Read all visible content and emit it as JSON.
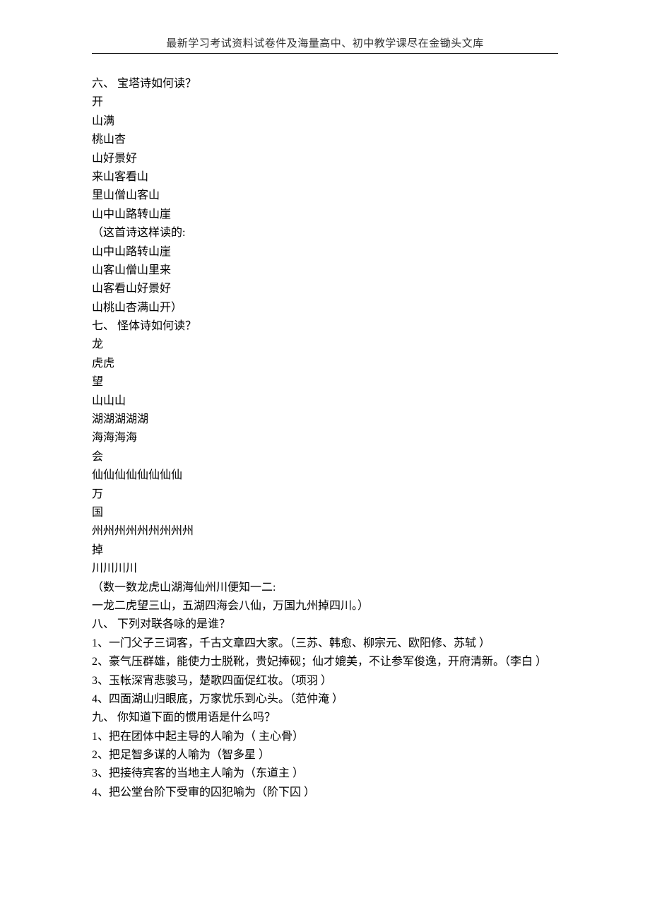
{
  "header": "最新学习考试资料试卷件及海量高中、初中教学课尽在金锄头文库",
  "lines": [
    "六、 宝塔诗如何读？",
    "开",
    "山满",
    "桃山杏",
    "山好景好",
    "来山客看山",
    "里山僧山客山",
    "山中山路转山崖",
    "（这首诗这样读的:",
    "山中山路转山崖",
    "山客山僧山里来",
    "山客看山好景好",
    "山桃山杏满山开）",
    "七、 怪体诗如何读？",
    "龙",
    "虎虎",
    "望",
    "山山山",
    "湖湖湖湖湖",
    "海海海海",
    "会",
    "仙仙仙仙仙仙仙仙",
    "万",
    "国",
    "州州州州州州州州州",
    "掉",
    "川川川川",
    "（数一数龙虎山湖海仙州川便知一二:",
    "一龙二虎望三山，五湖四海会八仙，万国九州掉四川。）",
    "八、 下列对联各咏的是谁？",
    "1、一门父子三词客，千古文章四大家。（三苏、韩愈、柳宗元、欧阳修、苏轼 ）",
    "2、豪气压群雄，能使力士脱靴，贵妃捧砚；仙才媲美，不让参军俊逸，开府清新。（李白 ）",
    "3、玉帐深宵悲骏马，楚歌四面促红妆。（项羽 ）",
    "4、四面湖山归眼底，万家忧乐到心头。（范仲淹 ）",
    "九、 你知道下面的惯用语是什么吗？",
    "1、把在团体中起主导的人喻为（ 主心骨）",
    "2、把足智多谋的人喻为（智多星 ）",
    "3、把接待宾客的当地主人喻为（东道主 ）",
    "4、把公堂台阶下受审的囚犯喻为（阶下囚 ）"
  ]
}
